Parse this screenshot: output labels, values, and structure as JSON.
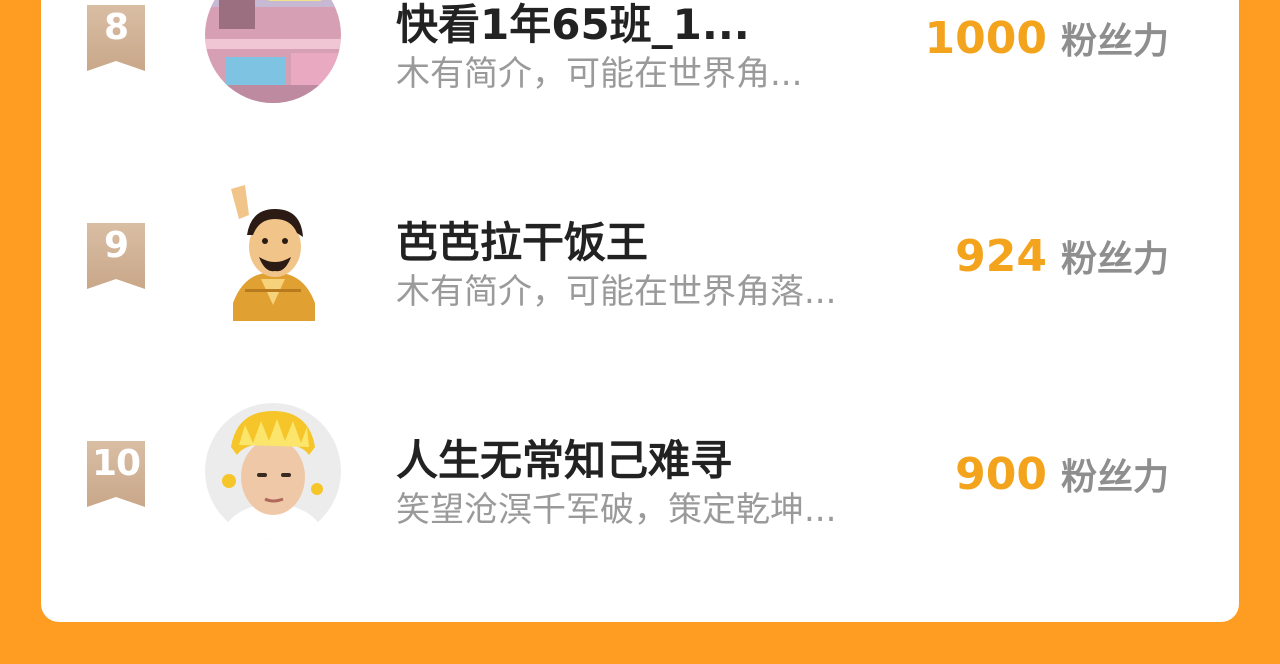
{
  "ranking": {
    "entries": [
      {
        "rank": "8",
        "name": "快看1年65班_1...",
        "bio": "木有简介，可能在世界角...",
        "fans_value": "1000",
        "fans_unit": "粉丝力",
        "avatar_icon": "anime-bus-avatar"
      },
      {
        "rank": "9",
        "name": "芭芭拉干饭王",
        "bio": "木有简介，可能在世界角落...",
        "fans_value": "924",
        "fans_unit": "粉丝力",
        "avatar_icon": "mustache-man-cartoon-avatar"
      },
      {
        "rank": "10",
        "name": "人生无常知己难寻",
        "bio": "笑望沧溟千军破，策定乾坤...",
        "fans_value": "900",
        "fans_unit": "粉丝力",
        "avatar_icon": "person-with-hat-avatar"
      }
    ]
  },
  "colors": {
    "page_background": "#ff9c22",
    "fans_value": "#f3a41c",
    "rank_badge": "#d6b89c"
  }
}
